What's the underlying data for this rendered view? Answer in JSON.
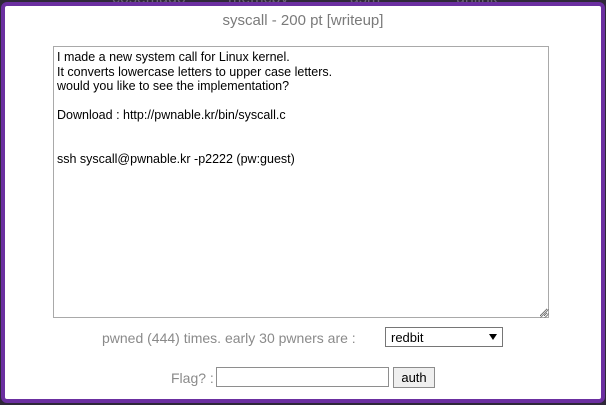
{
  "background": {
    "nav_items": [
      "cosemado",
      "memcpy",
      "asm",
      "unlink"
    ]
  },
  "challenge": {
    "title": "syscall - 200 pt [writeup]",
    "description": "I made a new system call for Linux kernel.\nIt converts lowercase letters to upper case letters.\nwould you like to see the implementation?\n\nDownload : http://pwnable.kr/bin/syscall.c\n\n\nssh syscall@pwnable.kr -p2222 (pw:guest)",
    "pwned_text": "pwned (444) times. early 30 pwners are :",
    "pwners_selected": "redbit",
    "flag_label": "Flag? :",
    "flag_value": "",
    "auth_label": "auth"
  },
  "colors": {
    "modal_border": "#6b2fa0",
    "page_background": "#2e2838",
    "muted_text": "#8a8a8a"
  }
}
